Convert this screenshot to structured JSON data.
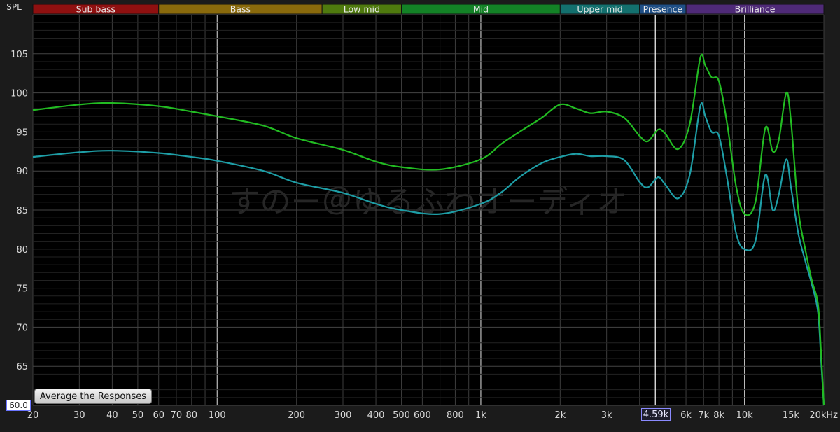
{
  "y_axis_label": "SPL",
  "y_min_value": "60.0",
  "cursor_readout": "4.59k",
  "average_button_label": "Average the Responses",
  "watermark": "すのー＠ゆるふわオーディオ",
  "bands": [
    {
      "label": "Sub bass",
      "from": 20,
      "to": 60,
      "color": "#8f1010"
    },
    {
      "label": "Bass",
      "from": 60,
      "to": 250,
      "color": "#8a6a0c"
    },
    {
      "label": "Low mid",
      "from": 250,
      "to": 500,
      "color": "#4f7a0e"
    },
    {
      "label": "Mid",
      "from": 500,
      "to": 2000,
      "color": "#138226"
    },
    {
      "label": "Upper mid",
      "from": 2000,
      "to": 4000,
      "color": "#13706e"
    },
    {
      "label": "Presence",
      "from": 4000,
      "to": 6000,
      "color": "#1f4f86"
    },
    {
      "label": "Brilliance",
      "from": 6000,
      "to": 20000,
      "color": "#4f2a78"
    }
  ],
  "chart_data": {
    "type": "line",
    "xlabel": "",
    "ylabel": "SPL",
    "x_scale": "log",
    "xlim": [
      20,
      20000
    ],
    "ylim": [
      60,
      110
    ],
    "x_ticks": [
      20,
      30,
      40,
      50,
      60,
      70,
      80,
      100,
      200,
      300,
      400,
      500,
      600,
      800,
      1000,
      2000,
      3000,
      6000,
      7000,
      8000,
      10000,
      15000
    ],
    "x_tick_labels": [
      "20",
      "30",
      "40",
      "50",
      "60",
      "70",
      "80",
      "100",
      "200",
      "300",
      "400",
      "500",
      "600",
      "800",
      "1k",
      "2k",
      "3k",
      "6k",
      "7k",
      "8k",
      "10k",
      "15k"
    ],
    "x_end_label": "20kHz",
    "y_ticks": [
      65,
      70,
      75,
      80,
      85,
      90,
      95,
      100,
      105
    ],
    "cursor_x": 4590,
    "grid": true,
    "series": [
      {
        "color": "#22bb22",
        "x": [
          20,
          30,
          40,
          60,
          80,
          100,
          150,
          200,
          300,
          400,
          500,
          700,
          1000,
          1200,
          1400,
          1700,
          2000,
          2300,
          2600,
          3000,
          3500,
          4000,
          4300,
          4700,
          5000,
          5600,
          6200,
          6800,
          7100,
          7500,
          8000,
          8600,
          9300,
          10000,
          11000,
          12000,
          12800,
          13500,
          14400,
          15000,
          16000,
          17000,
          18000,
          19000,
          19500,
          20000
        ],
        "y": [
          97.8,
          98.5,
          98.7,
          98.3,
          97.6,
          97.0,
          95.8,
          94.2,
          92.7,
          91.2,
          90.5,
          90.2,
          91.5,
          93.5,
          95.0,
          96.8,
          98.5,
          98.0,
          97.4,
          97.6,
          96.8,
          94.5,
          93.8,
          95.3,
          94.8,
          92.8,
          96.0,
          104.5,
          103.5,
          102.0,
          101.5,
          96.0,
          88.0,
          84.5,
          86.0,
          95.5,
          92.5,
          94.0,
          100.0,
          96.5,
          85.0,
          80.0,
          76.0,
          73.0,
          67.0,
          60.0
        ]
      },
      {
        "color": "#1e9ea6",
        "x": [
          20,
          30,
          40,
          60,
          80,
          100,
          150,
          200,
          300,
          400,
          500,
          700,
          1000,
          1200,
          1400,
          1700,
          2000,
          2300,
          2600,
          3000,
          3500,
          4000,
          4300,
          4700,
          5000,
          5600,
          6200,
          6800,
          7100,
          7500,
          8000,
          8600,
          9300,
          10000,
          11000,
          12000,
          12800,
          13500,
          14400,
          15000,
          16000,
          17000,
          18000,
          19000,
          19500,
          20000
        ],
        "y": [
          91.8,
          92.4,
          92.6,
          92.3,
          91.8,
          91.3,
          90.0,
          88.5,
          87.2,
          85.8,
          85.0,
          84.5,
          85.8,
          87.3,
          89.2,
          91.0,
          91.8,
          92.2,
          91.9,
          91.9,
          91.4,
          88.6,
          87.9,
          89.2,
          88.3,
          86.5,
          89.5,
          98.3,
          97.0,
          95.0,
          94.5,
          89.0,
          82.0,
          80.0,
          81.0,
          89.5,
          85.0,
          87.0,
          91.5,
          88.0,
          82.0,
          78.5,
          75.5,
          72.0,
          66.0,
          60.0
        ]
      }
    ]
  }
}
